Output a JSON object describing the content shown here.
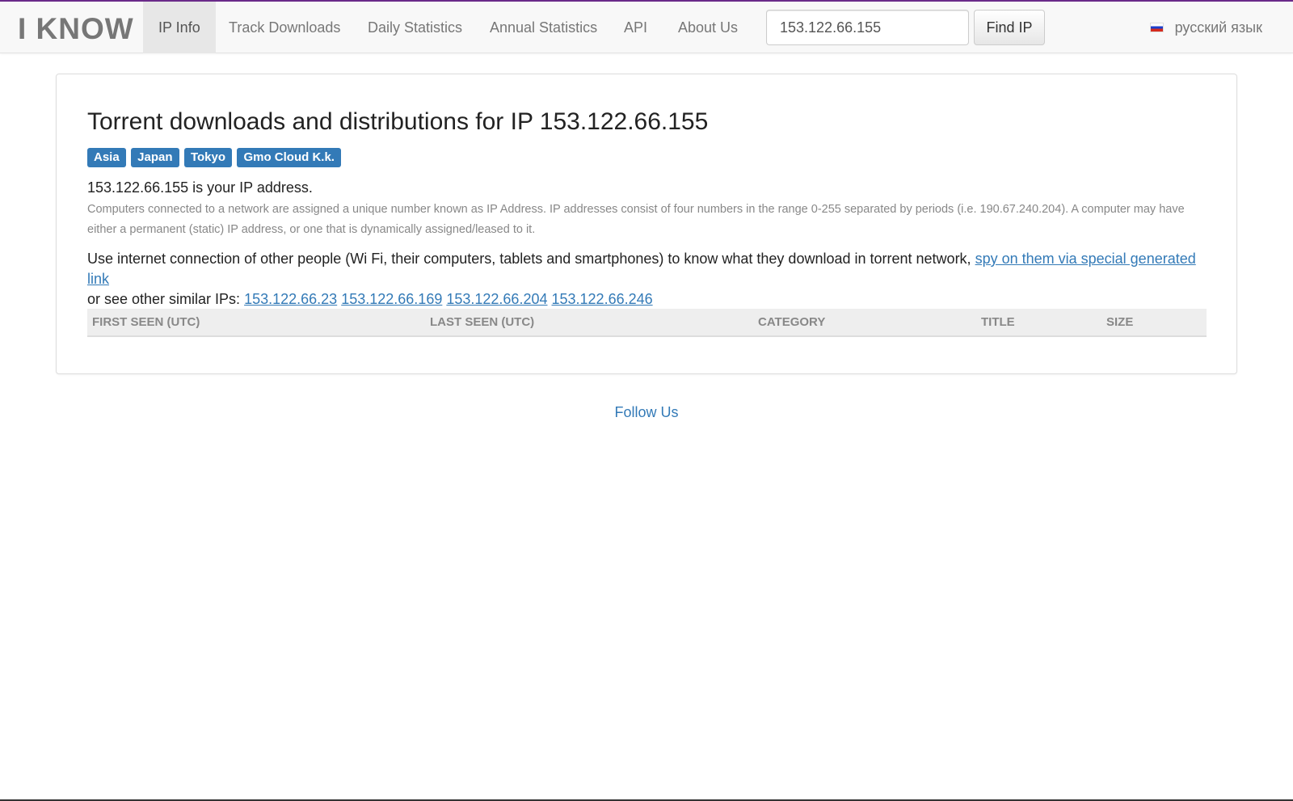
{
  "nav": {
    "brand": "I KNOW",
    "items": [
      {
        "label": "IP Info",
        "active": true
      },
      {
        "label": "Track Downloads",
        "active": false
      },
      {
        "label": "Daily Statistics",
        "active": false
      },
      {
        "label": "Annual Statistics",
        "active": false
      },
      {
        "label": "API",
        "active": false
      },
      {
        "label": "About Us",
        "active": false
      }
    ],
    "search": {
      "value": "153.122.66.155"
    },
    "find_label": "Find IP",
    "language": "русский язык"
  },
  "main": {
    "title": "Torrent downloads and distributions for IP 153.122.66.155",
    "badges": [
      "Asia",
      "Japan",
      "Tokyo",
      "Gmo Cloud K.k."
    ],
    "your_ip": "153.122.66.155 is your IP address.",
    "description": "Computers connected to a network are assigned a unique number known as IP Address. IP addresses consist of four numbers in the range 0-255 separated by periods (i.e. 190.67.240.204). A computer may have either a permanent (static) IP address, or one that is dynamically assigned/leased to it.",
    "usage_text": "Use internet connection of other people (Wi Fi, their computers, tablets and smartphones) to know what they download in torrent network,",
    "spy_link": "spy on them via special generated link",
    "similar_text": "or see other similar IPs:",
    "similar_ips": [
      "153.122.66.23",
      "153.122.66.169",
      "153.122.66.204",
      "153.122.66.246"
    ],
    "table_headers": [
      "FIRST SEEN (UTC)",
      "LAST SEEN (UTC)",
      "CATEGORY",
      "TITLE",
      "SIZE"
    ]
  },
  "footer": {
    "follow": "Follow Us"
  }
}
